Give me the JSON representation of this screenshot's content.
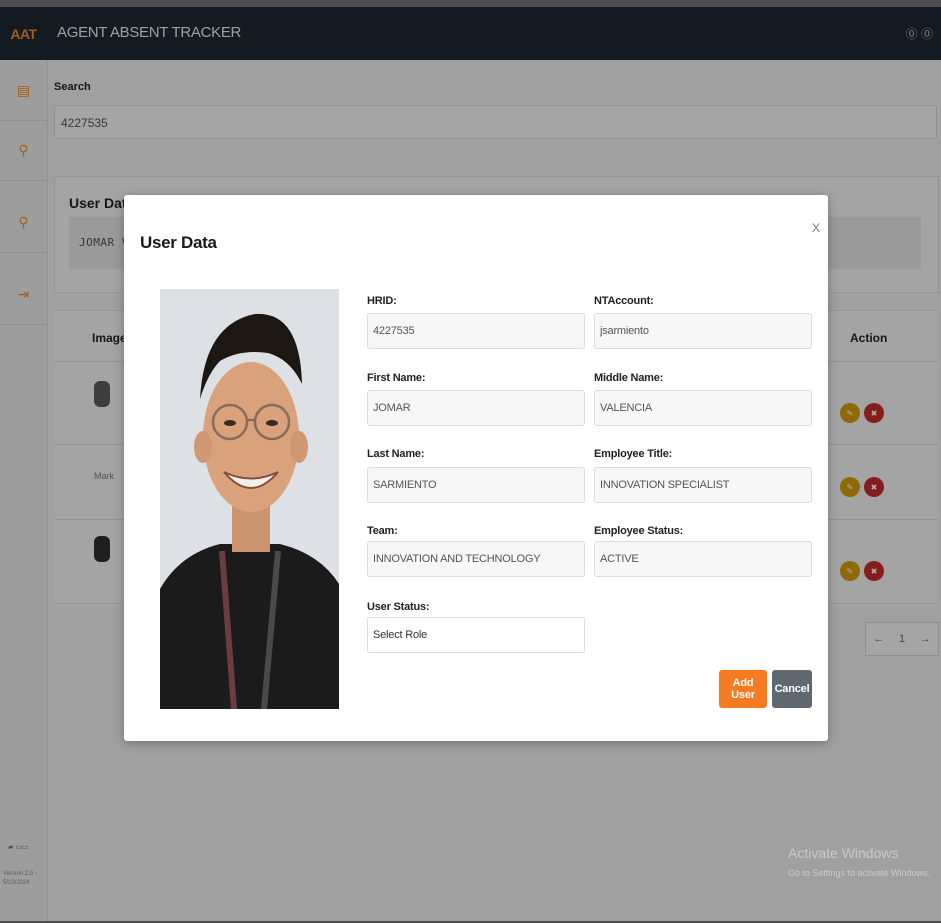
{
  "app": {
    "brand": "AAT",
    "title": "AGENT ABSENT TRACKER",
    "header_icons": "⓪ ⓪",
    "footer_logo": "▰ ▭▭",
    "version": "Version 2.0 - 5/10/2024"
  },
  "sidebar": {
    "items": [
      {
        "icon": "calendar-icon",
        "glyph": "▤"
      },
      {
        "icon": "user-add-icon",
        "glyph": "⚲"
      },
      {
        "icon": "user-search-icon",
        "glyph": "⚲"
      },
      {
        "icon": "logout-icon",
        "glyph": "⇥"
      }
    ]
  },
  "search": {
    "label": "Search",
    "value": "4227535"
  },
  "bg_card": {
    "title": "User Data",
    "value": "JOMAR VALEN"
  },
  "bg_table": {
    "col_image": "Image",
    "col_action": "Action",
    "rows": [
      {
        "name": ""
      },
      {
        "name": "Mark"
      },
      {
        "name": ""
      }
    ]
  },
  "pager": {
    "prev": "←",
    "page": "1",
    "next": "→"
  },
  "watermark": {
    "line1": "Activate Windows",
    "line2": "Go to Settings to activate Windows."
  },
  "modal": {
    "title": "User Data",
    "close": "X",
    "fields": {
      "hrid": {
        "label": "HRID:",
        "value": "4227535"
      },
      "ntaccount": {
        "label": "NTAccount:",
        "value": "jsarmiento"
      },
      "first_name": {
        "label": "First Name:",
        "value": "JOMAR"
      },
      "middle_name": {
        "label": "Middle Name:",
        "value": "VALENCIA"
      },
      "last_name": {
        "label": "Last Name:",
        "value": "SARMIENTO"
      },
      "employee_title": {
        "label": "Employee Title:",
        "value": "INNOVATION SPECIALIST"
      },
      "team": {
        "label": "Team:",
        "value": "INNOVATION AND TECHNOLOGY"
      },
      "employee_status": {
        "label": "Employee Status:",
        "value": "ACTIVE"
      },
      "user_status": {
        "label": "User Status:",
        "value": "Select Role"
      }
    },
    "add_button": "Add User",
    "cancel_button": "Cancel"
  },
  "colors": {
    "header": "#1e2733",
    "accent": "#f08a24",
    "add_button": "#f47b20",
    "cancel_button": "#5f6771",
    "edit_action": "#d39b09",
    "delete_action": "#c42b2b"
  }
}
